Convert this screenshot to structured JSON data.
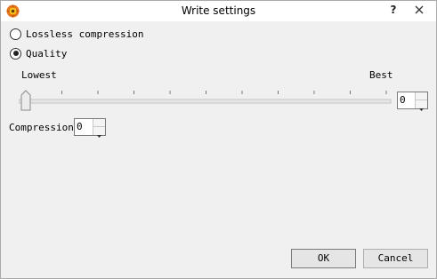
{
  "window": {
    "title": "Write settings",
    "help_label": "?"
  },
  "options": {
    "lossless_label": "Lossless compression",
    "quality_label": "Quality",
    "selected": "quality"
  },
  "quality": {
    "min_label": "Lowest",
    "max_label": "Best",
    "value": "0",
    "tick_count": 11
  },
  "compression": {
    "label": "Compression",
    "value": "0"
  },
  "buttons": {
    "ok_label": "OK",
    "cancel_label": "Cancel"
  },
  "colors": {
    "icon_orange": "#e8741c",
    "icon_yellow": "#f7c51c",
    "close_hover": "#c7c7c7"
  }
}
